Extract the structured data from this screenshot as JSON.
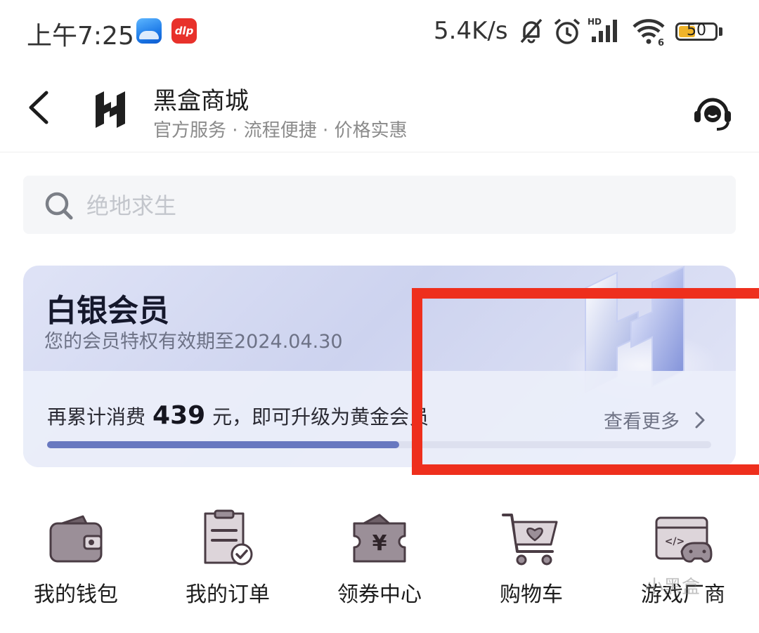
{
  "status_bar": {
    "time": "上午7:25",
    "app_badge": "dlp",
    "network_speed": "5.4K/s",
    "hd_label": "HD",
    "wifi_label": "6",
    "battery": "50",
    "battery_level": 0.5
  },
  "header": {
    "title": "黑盒商城",
    "subtitle": "官方服务 · 流程便捷 · 价格实惠"
  },
  "search": {
    "placeholder": "绝地求生"
  },
  "member_card": {
    "tier": "白银会员",
    "expiry": "您的会员特权有效期至2024.04.30",
    "upgrade_prefix": "再累计消费",
    "upgrade_amount": "439",
    "upgrade_suffix": "元，即可升级为黄金会员",
    "progress": 0.53,
    "view_more": "查看更多"
  },
  "quick_links": [
    {
      "label": "我的钱包",
      "icon": "wallet-icon"
    },
    {
      "label": "我的订单",
      "icon": "order-icon"
    },
    {
      "label": "领券中心",
      "icon": "coupon-icon"
    },
    {
      "label": "购物车",
      "icon": "cart-icon"
    },
    {
      "label": "游戏厂商",
      "icon": "game-vendor-icon"
    }
  ],
  "watermark": "小黑盒",
  "colors": {
    "accent": "#6878c0",
    "highlight": "#ee2f1d",
    "icon_fill": "#9b8f98",
    "icon_stroke": "#4a3c44"
  }
}
